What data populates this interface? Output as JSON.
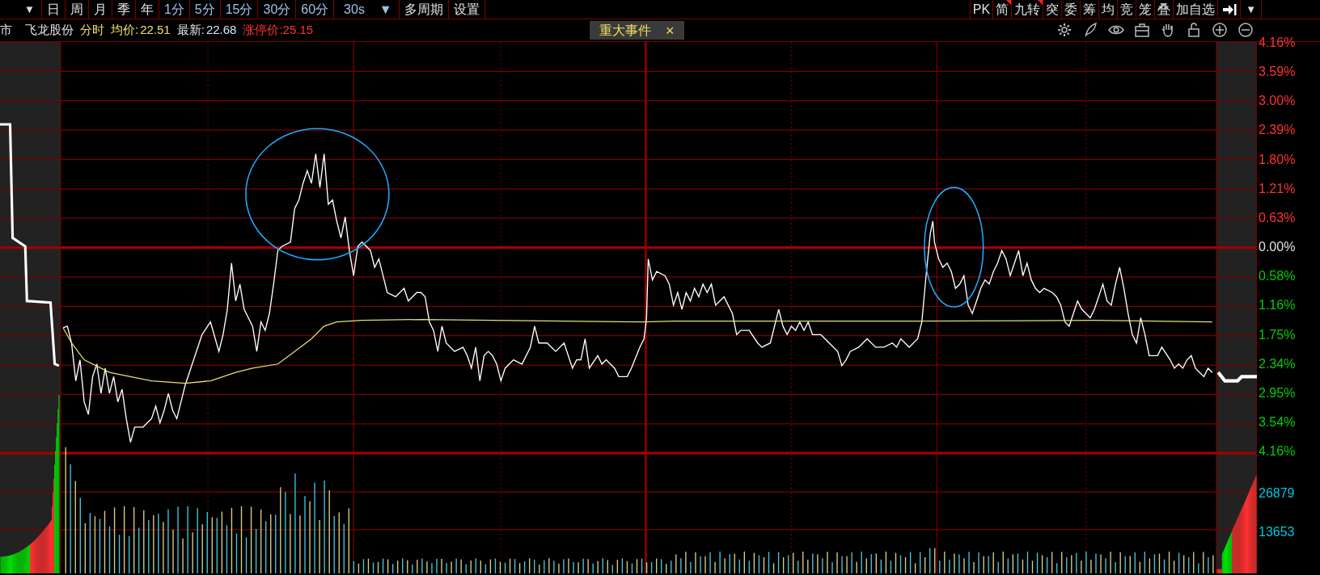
{
  "toolbar": {
    "left_items": [
      {
        "label": "▼",
        "kind": "caret"
      },
      {
        "label": "日",
        "kind": "cycle"
      },
      {
        "label": "周",
        "kind": "cycle"
      },
      {
        "label": "月",
        "kind": "cycle"
      },
      {
        "label": "季",
        "kind": "cycle"
      },
      {
        "label": "年",
        "kind": "cycle"
      },
      {
        "label": "1分",
        "kind": "minute"
      },
      {
        "label": "5分",
        "kind": "minute"
      },
      {
        "label": "15分",
        "kind": "minute"
      },
      {
        "label": "30分",
        "kind": "minute"
      },
      {
        "label": "60分",
        "kind": "minute"
      },
      {
        "label": "30s",
        "kind": "dropdown",
        "caret": "▼"
      },
      {
        "label": "多周期",
        "kind": "cycle"
      },
      {
        "label": "设置",
        "kind": "cycle"
      }
    ],
    "right_items": [
      {
        "label": "PK",
        "flagged": false
      },
      {
        "label": "简",
        "flagged": true
      },
      {
        "label": "九转",
        "flagged": true
      },
      {
        "label": "突",
        "flagged": false
      },
      {
        "label": "委",
        "flagged": false
      },
      {
        "label": "筹",
        "flagged": false
      },
      {
        "label": "均",
        "flagged": false
      },
      {
        "label": "竞",
        "flagged": false
      },
      {
        "label": "笼",
        "flagged": false
      },
      {
        "label": "叠",
        "flagged": false
      },
      {
        "label": "加自选",
        "flagged": false
      }
    ],
    "menu_caret": "▼"
  },
  "quote": {
    "market": "市",
    "name": "飞龙股份",
    "mode": "分时",
    "avg_label": "均价:",
    "avg_value": "22.51",
    "last_label": "最新:",
    "last_value": "22.68",
    "limit_up": "涨停价:25.15"
  },
  "event_tab": {
    "label": "重大事件",
    "close": "×"
  },
  "tools": [
    {
      "kind": "settings"
    },
    {
      "kind": "pen"
    },
    {
      "kind": "eye"
    },
    {
      "kind": "toolbox"
    },
    {
      "kind": "hand"
    },
    {
      "kind": "lock"
    },
    {
      "kind": "zoom-in"
    },
    {
      "kind": "zoom-out"
    }
  ],
  "price_axis": [
    {
      "label": "4.16%",
      "color": "#ff3232"
    },
    {
      "label": "3.59%",
      "color": "#ff3232"
    },
    {
      "label": "3.00%",
      "color": "#ff3232"
    },
    {
      "label": "2.39%",
      "color": "#ff3232"
    },
    {
      "label": "1.80%",
      "color": "#ff3232"
    },
    {
      "label": "1.21%",
      "color": "#ff3232"
    },
    {
      "label": "0.63%",
      "color": "#ff3232"
    },
    {
      "label": "0.00%",
      "color": "#e0e0e0"
    },
    {
      "label": "0.58%",
      "color": "#00d000"
    },
    {
      "label": "1.16%",
      "color": "#00d000"
    },
    {
      "label": "1.75%",
      "color": "#00d000"
    },
    {
      "label": "2.34%",
      "color": "#00d000"
    },
    {
      "label": "2.95%",
      "color": "#00d000"
    },
    {
      "label": "3.54%",
      "color": "#00d000"
    },
    {
      "label": "4.16%",
      "color": "#00d000"
    }
  ],
  "volume_axis": [
    "26879",
    "13653"
  ]
}
